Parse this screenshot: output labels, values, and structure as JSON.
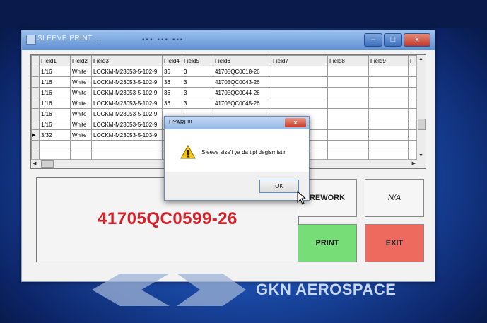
{
  "window": {
    "title": "SLEEVE PRINT ...",
    "controls": {
      "minimize": "–",
      "maximize": "□",
      "close": "x"
    }
  },
  "grid": {
    "columns": [
      "Field1",
      "Field2",
      "Field3",
      "Field4",
      "Field5",
      "Field6",
      "Field7",
      "Field8",
      "Field9",
      "F"
    ],
    "rows": [
      [
        "1/16",
        "White",
        "LOCKM-M23053-5-102-9",
        "36",
        "3",
        "41705QC0018-26",
        "",
        "",
        "",
        ""
      ],
      [
        "1/16",
        "White",
        "LOCKM-M23053-5-102-9",
        "36",
        "3",
        "41705QC0043-26",
        "",
        "",
        "",
        ""
      ],
      [
        "1/16",
        "White",
        "LOCKM-M23053-5-102-9",
        "36",
        "3",
        "41705QC0044-26",
        "",
        "",
        "",
        ""
      ],
      [
        "1/16",
        "White",
        "LOCKM-M23053-5-102-9",
        "36",
        "3",
        "41705QC0045-26",
        "",
        "",
        "",
        ""
      ],
      [
        "1/16",
        "White",
        "LOCKM-M23053-5-102-9",
        "",
        "",
        "",
        "",
        "",
        "",
        ""
      ],
      [
        "1/16",
        "White",
        "LOCKM-M23053-5-102-9",
        "",
        "",
        "",
        "",
        "",
        "",
        ""
      ],
      [
        "3/32",
        "White",
        "LOCKM-M23053-5-103-9",
        "",
        "",
        "",
        "",
        "",
        "",
        ""
      ]
    ],
    "current_row_index": 6
  },
  "main": {
    "code": "41705QC0599-26"
  },
  "buttons": {
    "rework": "REWORK",
    "na": "N/A",
    "print": "PRINT",
    "exit": "EXIT"
  },
  "dialog": {
    "title": "UYARI !!!",
    "message": "Sleeve size'i ya da tipi degismistir",
    "ok_label": "OK",
    "close_label": "x",
    "icon": "warning-icon"
  },
  "brand": {
    "logo_text": "GKN AEROSPACE"
  },
  "colors": {
    "code_red": "#d8202a",
    "print_green": "#77dd77",
    "exit_red": "#ee6a5f",
    "desktop_blue": "#1a4aa6"
  }
}
